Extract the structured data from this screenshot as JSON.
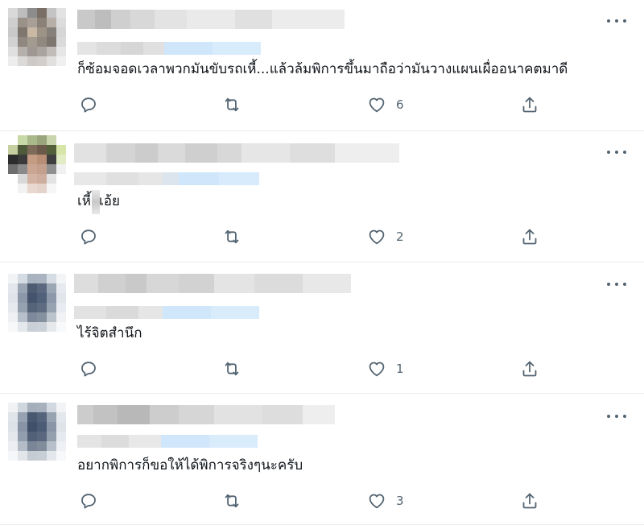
{
  "colors": {
    "icon": "#536471",
    "text": "#0f1419",
    "divider": "#e9ecef",
    "blurred_handle_accent": "#cfe6fb"
  },
  "more_icon": "more-horizontal-icon",
  "reply_icon": "speech-bubble-icon",
  "retweet_icon": "retweet-arrows-icon",
  "like_icon": "heart-outline-icon",
  "share_icon": "share-upload-icon",
  "replies": [
    {
      "text": "ก็ซ้อมจอดเวลาพวกมันขับรถเหี้...แล้วล้มพิการขึ้นมาถือว่ามันวางแผนเผื่ออนาคตมาดี",
      "likes": "6"
    },
    {
      "text": "เหี้ยเอ้ย",
      "likes": "2"
    },
    {
      "text": "ไร้จิตสำนึก",
      "likes": "1"
    },
    {
      "text": "อยากพิการก็ขอให้ได้พิการจริงๆนะครับ",
      "likes": "3"
    }
  ]
}
